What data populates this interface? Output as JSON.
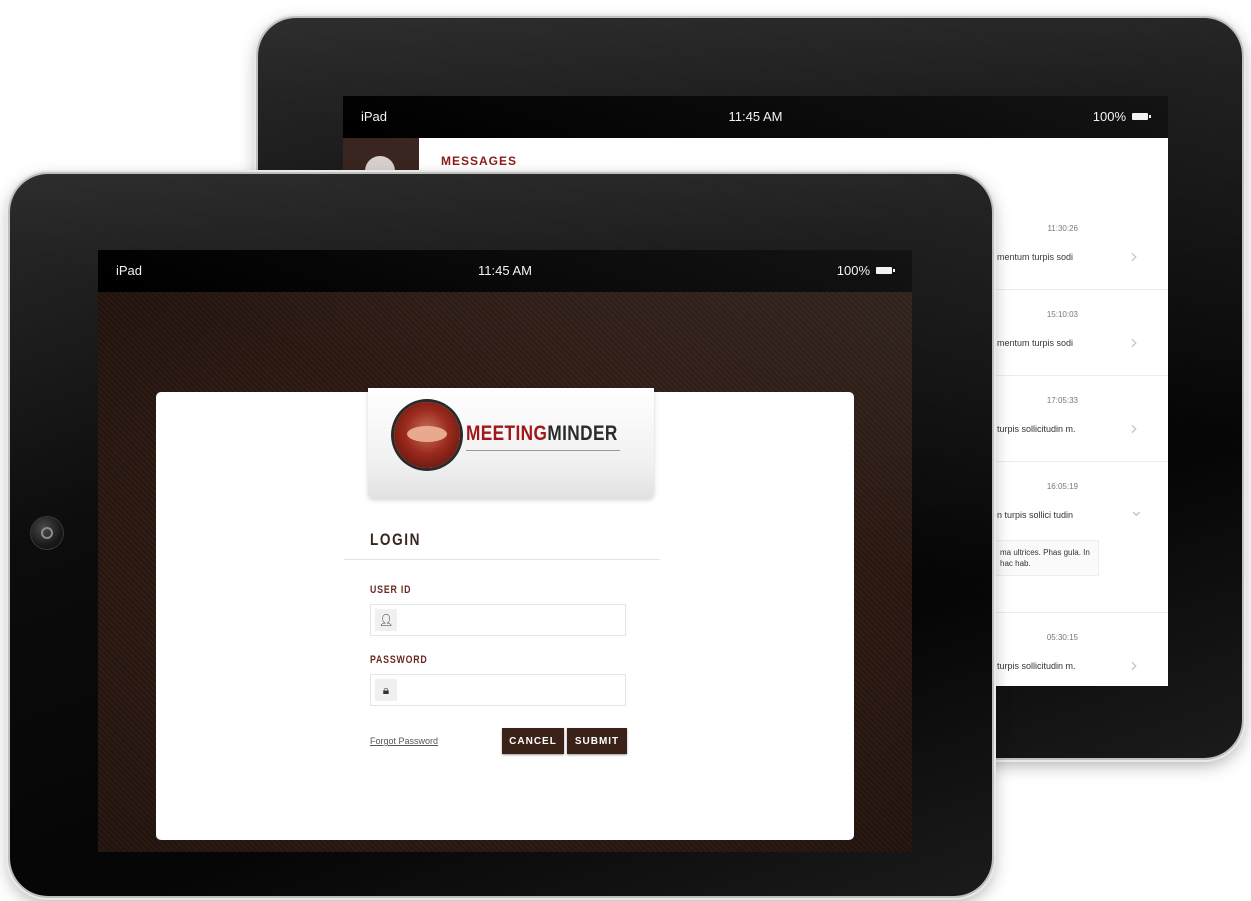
{
  "back_ipad": {
    "statusbar": {
      "carrier": "iPad",
      "time": "11:45 AM",
      "battery": "100%"
    },
    "messages": {
      "title": "MESSAGES",
      "rows": [
        {
          "time": "11:30:26",
          "snippet": "mentum turpis sodi"
        },
        {
          "time": "15:10:03",
          "snippet": "mentum turpis sodi"
        },
        {
          "time": "17:05:33",
          "snippet": "turpis sollicitudin m."
        },
        {
          "time": "16:05:19",
          "snippet": "n turpis sollici tudin",
          "expanded_text": "ma ultrices. Phas gula. In hac hab."
        },
        {
          "time": "05:30:15",
          "snippet": "turpis sollicitudin m."
        }
      ]
    }
  },
  "front_ipad": {
    "statusbar": {
      "carrier": "iPad",
      "time": "11:45 AM",
      "battery": "100%"
    },
    "logo": {
      "word1": "MEETING",
      "word2": "MINDER"
    },
    "login": {
      "heading": "LOGIN",
      "user_label": "USER ID",
      "user_value": "",
      "password_label": "PASSWORD",
      "password_value": "",
      "forgot_label": "Forgot Password",
      "cancel_label": "CANCEL",
      "submit_label": "SUBMIT"
    }
  },
  "colors": {
    "brand_red": "#a0181a",
    "leather_brown": "#2c1912",
    "button_brown": "#3a2218",
    "label_brown": "#6a2a22"
  },
  "icons": {
    "user_field": "user-icon",
    "password_field": "lock-icon",
    "row_chevron": "chevron-right-icon",
    "expanded_chevron": "chevron-down-icon",
    "battery": "battery-icon"
  }
}
